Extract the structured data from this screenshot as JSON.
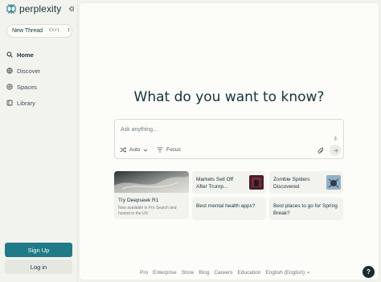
{
  "brand": {
    "name": "perplexity"
  },
  "sidebar": {
    "new_thread": {
      "label": "New Thread",
      "kbd1": "Ctrl",
      "kbd2": "I"
    },
    "items": [
      {
        "label": "Home",
        "icon": "search-icon",
        "active": true
      },
      {
        "label": "Discover",
        "icon": "globe-icon",
        "active": false
      },
      {
        "label": "Spaces",
        "icon": "spaces-icon",
        "active": false
      },
      {
        "label": "Library",
        "icon": "library-icon",
        "active": false
      }
    ],
    "signup_label": "Sign Up",
    "login_label": "Log in"
  },
  "main": {
    "headline": "What do you want to know?",
    "ask": {
      "placeholder": "Ask anything...",
      "auto_label": "Auto",
      "focus_label": "Focus"
    },
    "feature_card": {
      "title": "Try Deepseek R1",
      "subtitle": "Now available in Pro Search and hosted in the US"
    },
    "cards": [
      {
        "title": "Markets Sell Off After Trump..."
      },
      {
        "title": "Zombie Spiders Discovered"
      },
      {
        "title": "Best mental health apps?"
      },
      {
        "title": "Best places to go for Spring Break?"
      }
    ],
    "footer": [
      "Pro",
      "Enterprise",
      "Store",
      "Blog",
      "Careers",
      "Education",
      "English (English)"
    ],
    "help_label": "?"
  },
  "colors": {
    "accent": "#217a87",
    "background": "#f3f3ee",
    "panel": "#fcfcf9",
    "text": "#13343b"
  }
}
